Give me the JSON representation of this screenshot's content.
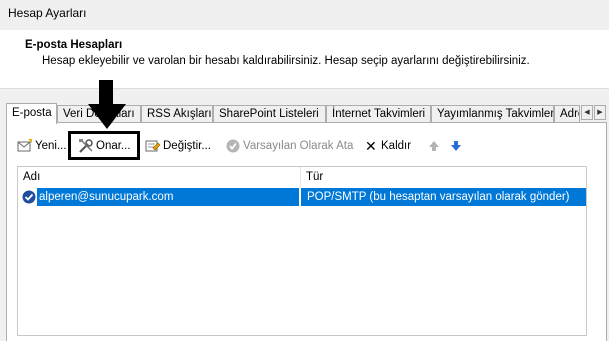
{
  "window": {
    "title": "Hesap Ayarları"
  },
  "header": {
    "title": "E-posta Hesapları",
    "description": "Hesap ekleyebilir ve varolan bir hesabı kaldırabilirsiniz. Hesap seçip ayarlarını değiştirebilirsiniz."
  },
  "tabs": [
    {
      "label": "E-posta"
    },
    {
      "label": "Veri Dosyaları"
    },
    {
      "label": "RSS Akışları"
    },
    {
      "label": "SharePoint Listeleri"
    },
    {
      "label": "İnternet Takvimleri"
    },
    {
      "label": "Yayımlanmış Takvimler"
    },
    {
      "label": "Adres Defterleri"
    }
  ],
  "tab_scroll": {
    "left": "◀",
    "right": "▶"
  },
  "toolbar": {
    "new_label": "Yeni...",
    "repair_label": "Onar...",
    "change_label": "Değiştir...",
    "set_default_label": "Varsayılan Olarak Ata",
    "remove_label": "Kaldır",
    "remove_glyph": "✕",
    "move_up_glyph": "🡅",
    "move_down_glyph": "🡇"
  },
  "list": {
    "columns": [
      "Adı",
      "Tür"
    ],
    "rows": [
      {
        "name": "alperen@sunucupark.com",
        "type": "POP/SMTP (bu hesaptan varsayılan olarak gönder)"
      }
    ]
  },
  "colors": {
    "selection": "#0078d7",
    "disabled_text": "#8a8a8a",
    "highlight_border": "#000000"
  },
  "icons": {
    "new": "new-email-account-icon",
    "repair": "wrench-tools-icon",
    "change": "change-account-icon",
    "set_default": "checkmark-circle-icon",
    "remove": "close-x-icon",
    "move_up": "arrow-up-icon",
    "move_down": "arrow-down-icon",
    "annotation": "down-arrow-annotation-icon"
  }
}
